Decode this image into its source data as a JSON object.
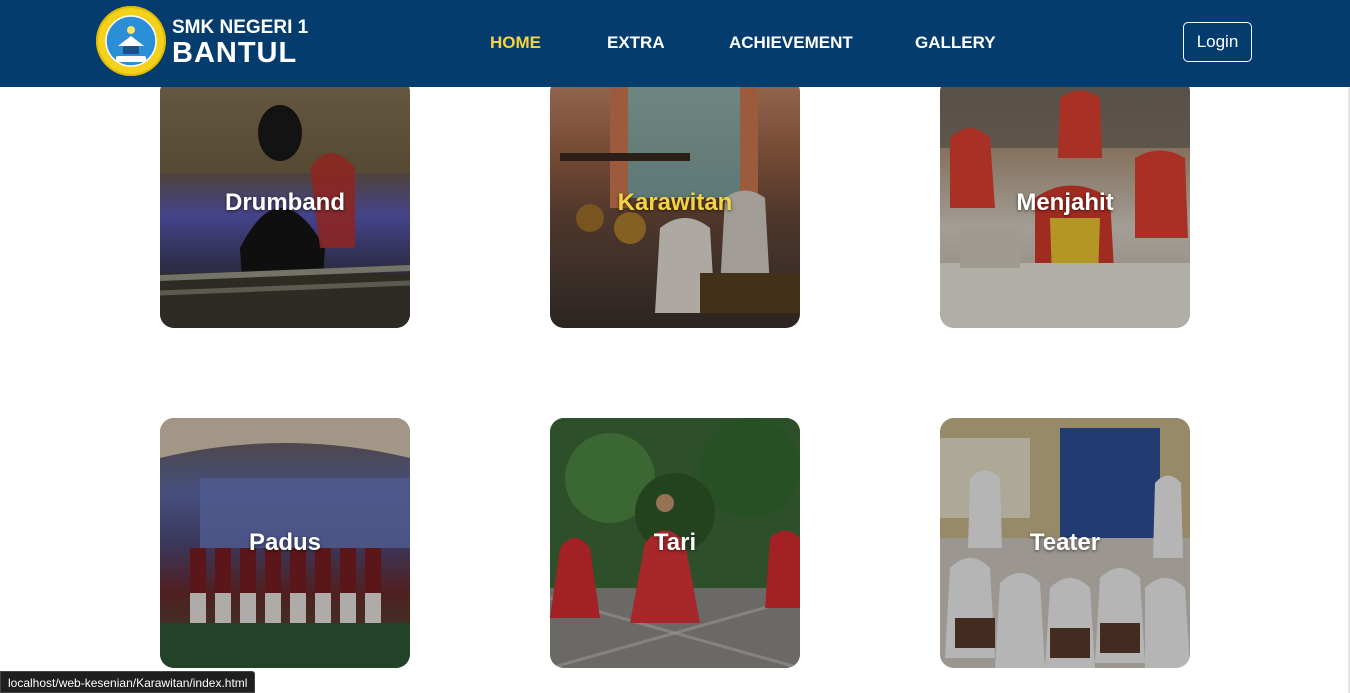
{
  "brand": {
    "line1": "SMK NEGERI 1",
    "line2": "BANTUL",
    "emblem_text": "SMK NEGERI 1 BANTUL"
  },
  "nav": {
    "items": [
      {
        "label": "HOME",
        "active": true
      },
      {
        "label": "EXTRA",
        "active": false
      },
      {
        "label": "ACHIEVEMENT",
        "active": false
      },
      {
        "label": "GALLERY",
        "active": false
      }
    ],
    "login_label": "Login"
  },
  "cards": [
    {
      "label": "Drumband",
      "hover": false
    },
    {
      "label": "Karawitan",
      "hover": true
    },
    {
      "label": "Menjahit",
      "hover": false
    },
    {
      "label": "Padus",
      "hover": false
    },
    {
      "label": "Tari",
      "hover": false
    },
    {
      "label": "Teater",
      "hover": false
    }
  ],
  "status_url": "localhost/web-kesenian/Karawitan/index.html",
  "colors": {
    "navbar": "#053c6e",
    "active_nav": "#f5d442",
    "hover_label": "#f5d442"
  }
}
